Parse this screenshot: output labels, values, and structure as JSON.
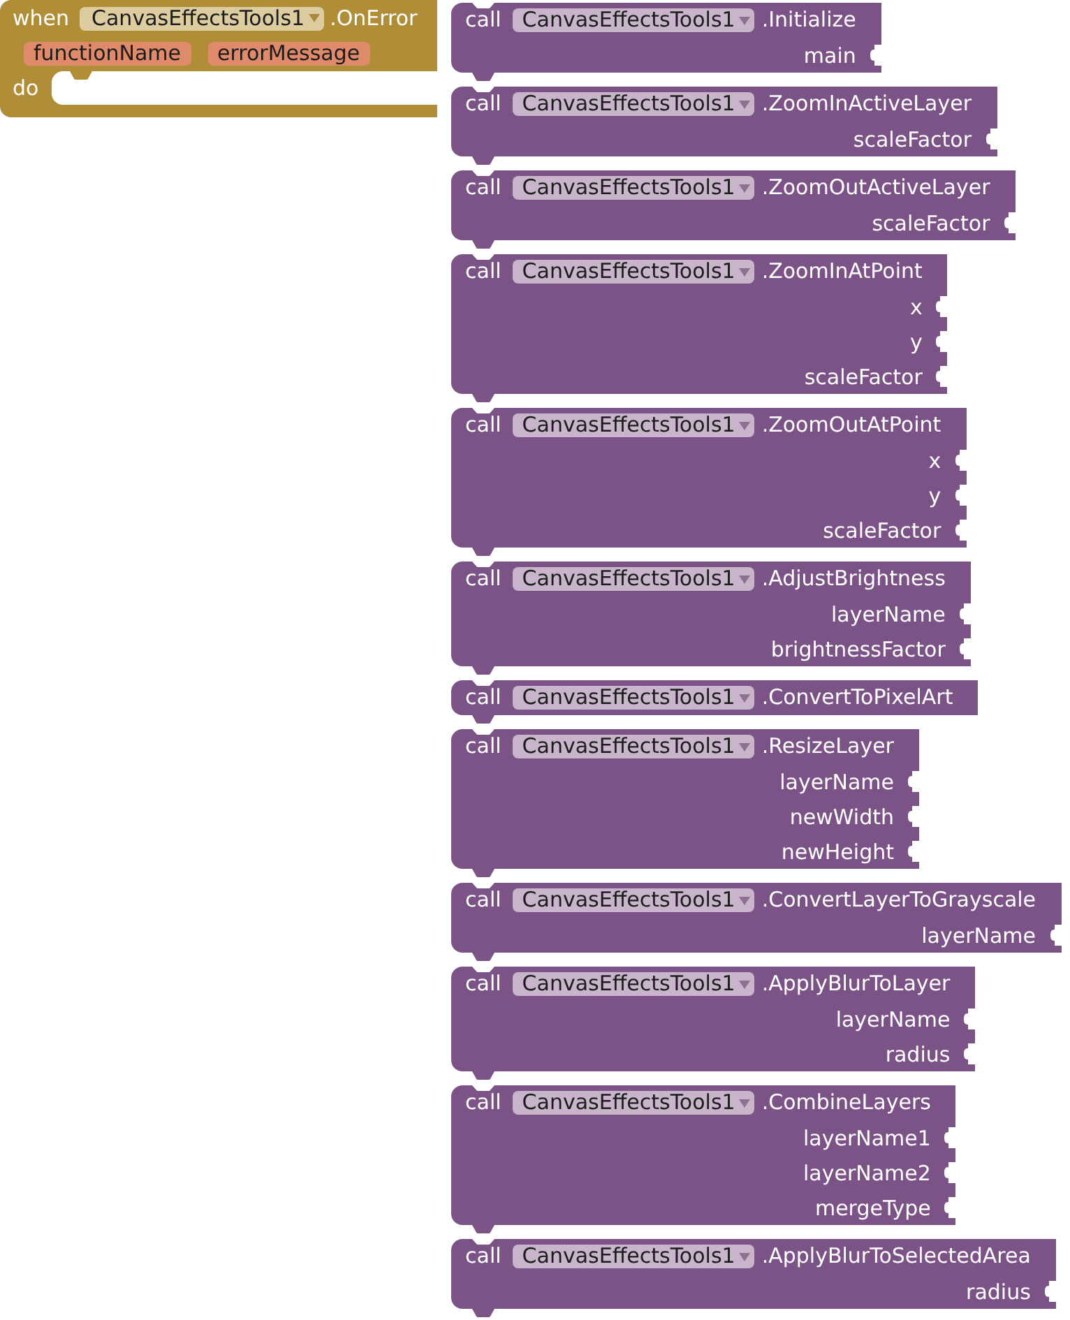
{
  "event_block": {
    "keyword": "when",
    "component": "CanvasEffectsTools1",
    "event": ".OnError",
    "parameters": [
      "functionName",
      "errorMessage"
    ],
    "statement_label": "do"
  },
  "call_blocks": [
    {
      "keyword": "call",
      "component": "CanvasEffectsTools1",
      "method": ".Initialize",
      "arguments": [
        "main"
      ]
    },
    {
      "keyword": "call",
      "component": "CanvasEffectsTools1",
      "method": ".ZoomInActiveLayer",
      "arguments": [
        "scaleFactor"
      ]
    },
    {
      "keyword": "call",
      "component": "CanvasEffectsTools1",
      "method": ".ZoomOutActiveLayer",
      "arguments": [
        "scaleFactor"
      ]
    },
    {
      "keyword": "call",
      "component": "CanvasEffectsTools1",
      "method": ".ZoomInAtPoint",
      "arguments": [
        "x",
        "y",
        "scaleFactor"
      ]
    },
    {
      "keyword": "call",
      "component": "CanvasEffectsTools1",
      "method": ".ZoomOutAtPoint",
      "arguments": [
        "x",
        "y",
        "scaleFactor"
      ]
    },
    {
      "keyword": "call",
      "component": "CanvasEffectsTools1",
      "method": ".AdjustBrightness",
      "arguments": [
        "layerName",
        "brightnessFactor"
      ]
    },
    {
      "keyword": "call",
      "component": "CanvasEffectsTools1",
      "method": ".ConvertToPixelArt"
    },
    {
      "keyword": "call",
      "component": "CanvasEffectsTools1",
      "method": ".ResizeLayer",
      "arguments": [
        "layerName",
        "newWidth",
        "newHeight"
      ]
    },
    {
      "keyword": "call",
      "component": "CanvasEffectsTools1",
      "method": ".ConvertLayerToGrayscale",
      "arguments": [
        "layerName"
      ]
    },
    {
      "keyword": "call",
      "component": "CanvasEffectsTools1",
      "method": ".ApplyBlurToLayer",
      "arguments": [
        "layerName",
        "radius"
      ]
    },
    {
      "keyword": "call",
      "component": "CanvasEffectsTools1",
      "method": ".CombineLayers",
      "arguments": [
        "layerName1",
        "layerName2",
        "mergeType"
      ]
    },
    {
      "keyword": "call",
      "component": "CanvasEffectsTools1",
      "method": ".ApplyBlurToSelectedArea",
      "arguments": [
        "radius"
      ]
    }
  ]
}
